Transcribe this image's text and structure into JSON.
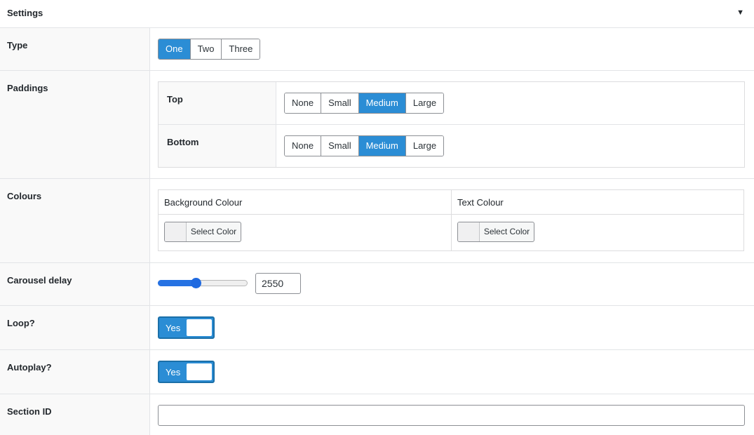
{
  "panel": {
    "title": "Settings",
    "toggle_icon": "triangle-down-icon"
  },
  "fields": {
    "type": {
      "label": "Type",
      "options": [
        "One",
        "Two",
        "Three"
      ],
      "selected": "One"
    },
    "paddings": {
      "label": "Paddings",
      "top": {
        "label": "Top",
        "options": [
          "None",
          "Small",
          "Medium",
          "Large"
        ],
        "selected": "Medium"
      },
      "bottom": {
        "label": "Bottom",
        "options": [
          "None",
          "Small",
          "Medium",
          "Large"
        ],
        "selected": "Medium"
      }
    },
    "colours": {
      "label": "Colours",
      "background": {
        "header": "Background Colour",
        "button": "Select Color"
      },
      "text": {
        "header": "Text Colour",
        "button": "Select Color"
      }
    },
    "carousel_delay": {
      "label": "Carousel delay",
      "value": "2550",
      "slider_level_percent": 42
    },
    "loop": {
      "label": "Loop?",
      "toggle_text": "Yes",
      "on": true
    },
    "autoplay": {
      "label": "Autoplay?",
      "toggle_text": "Yes",
      "on": true
    },
    "section_id": {
      "label": "Section ID",
      "value": ""
    }
  },
  "colors": {
    "accent": "#2b8dd5",
    "label_bg": "#f9f9f9",
    "border": "#e2e4e7"
  }
}
